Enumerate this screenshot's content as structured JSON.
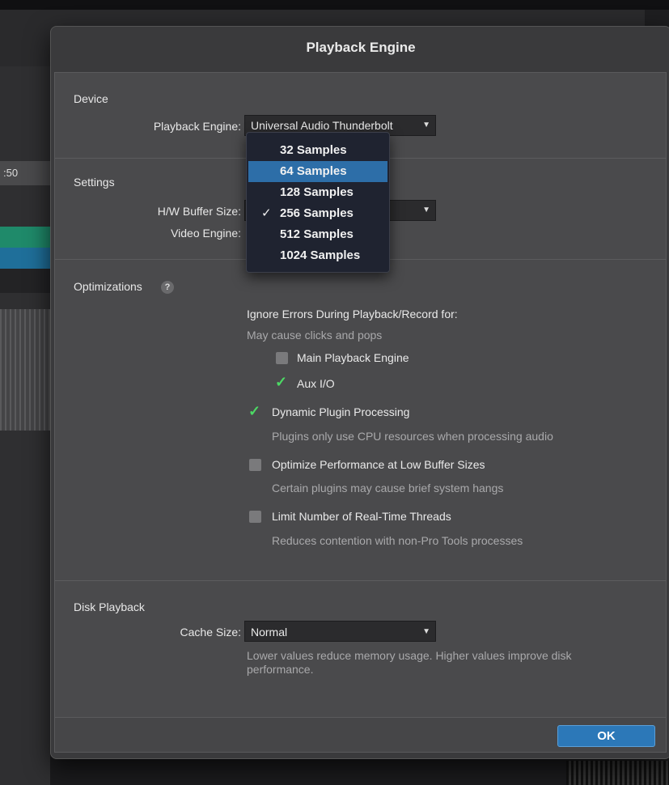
{
  "background": {
    "timecode": ":50"
  },
  "dialog": {
    "title": "Playback Engine"
  },
  "device": {
    "section": "Device",
    "engine_label": "Playback Engine:",
    "engine_value": "Universal Audio Thunderbolt"
  },
  "settings": {
    "section": "Settings",
    "buffer_label": "H/W Buffer Size:",
    "video_label": "Video Engine:"
  },
  "buffer_menu": {
    "items": [
      "32 Samples",
      "64 Samples",
      "128 Samples",
      "256 Samples",
      "512 Samples",
      "1024 Samples"
    ],
    "highlighted": "64 Samples",
    "selected": "256 Samples",
    "check_glyph": "✓"
  },
  "optimizations": {
    "section": "Optimizations",
    "help": "?",
    "ignore_heading": "Ignore Errors During Playback/Record for:",
    "ignore_sub": "May cause clicks and pops",
    "main_engine": {
      "label": "Main Playback Engine",
      "checked": false
    },
    "aux_io": {
      "label": "Aux I/O",
      "checked": true
    },
    "dynamic": {
      "label": "Dynamic Plugin Processing",
      "desc": "Plugins only use CPU resources when processing audio",
      "checked": true
    },
    "optimize_low": {
      "label": "Optimize Performance at Low Buffer Sizes",
      "desc": "Certain plugins may cause brief system hangs",
      "checked": false
    },
    "limit_threads": {
      "label": "Limit Number of Real-Time Threads",
      "desc": "Reduces contention with non-Pro Tools processes",
      "checked": false
    }
  },
  "disk": {
    "section": "Disk Playback",
    "cache_label": "Cache Size:",
    "cache_value": "Normal",
    "cache_desc_1": "Lower values reduce memory usage. Higher values improve disk",
    "cache_desc_2": "performance."
  },
  "footer": {
    "ok_label": "OK"
  },
  "colors": {
    "accent": "#2c78b8",
    "check": "#4cd964",
    "menu_highlight": "#2d6ea8"
  }
}
